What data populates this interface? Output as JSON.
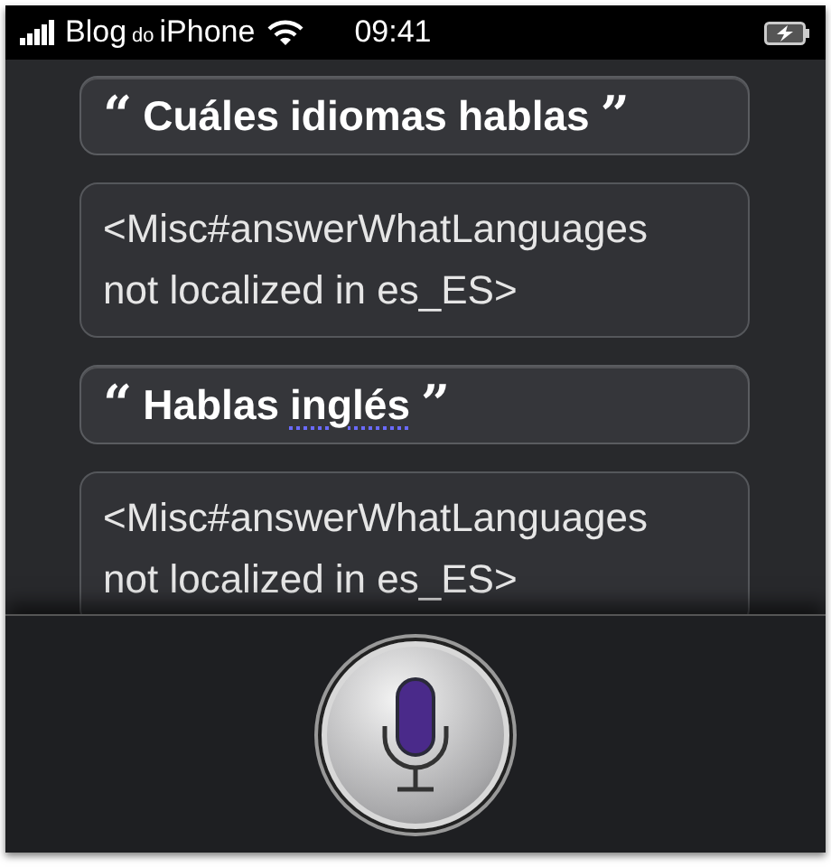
{
  "status_bar": {
    "carrier": [
      "Blog",
      "do",
      "iPhone"
    ],
    "time": "09:41"
  },
  "conversation": [
    {
      "kind": "user",
      "open_quote": "“",
      "close_quote": "”",
      "words": [
        {
          "text": "Cuáles",
          "flagged": false
        },
        {
          "text": "idiomas",
          "flagged": false
        },
        {
          "text": "hablas",
          "flagged": false
        }
      ]
    },
    {
      "kind": "answer",
      "lines": [
        "<Misc#answerWhatLanguages",
        "not localized in es_ES>"
      ]
    },
    {
      "kind": "user",
      "open_quote": "“",
      "close_quote": "”",
      "words": [
        {
          "text": "Hablas",
          "flagged": false
        },
        {
          "text": "inglés",
          "flagged": true
        }
      ]
    },
    {
      "kind": "answer",
      "lines": [
        "<Misc#answerWhatLanguages",
        "not localized in es_ES>"
      ]
    }
  ]
}
